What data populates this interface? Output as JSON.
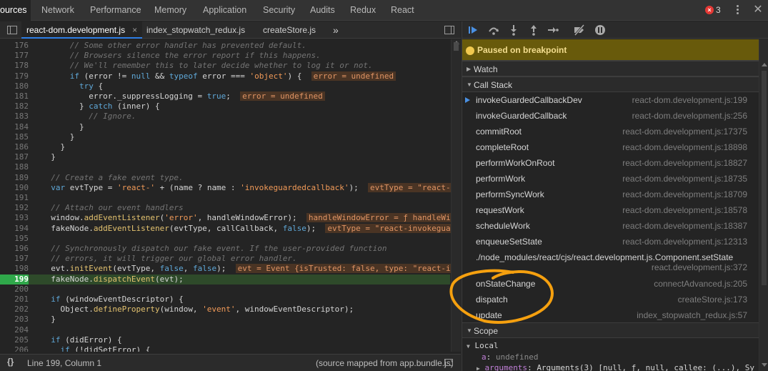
{
  "top_tabs": [
    {
      "label": "ources",
      "active": true
    },
    {
      "label": "Network",
      "active": false
    },
    {
      "label": "Performance",
      "active": false
    },
    {
      "label": "Memory",
      "active": false
    },
    {
      "label": "Application",
      "active": false
    },
    {
      "label": "Security",
      "active": false
    },
    {
      "label": "Audits",
      "active": false
    },
    {
      "label": "Redux",
      "active": false
    },
    {
      "label": "React",
      "active": false
    }
  ],
  "errors": {
    "count": "3",
    "icon": "error-circle-icon",
    "color": "#e53935"
  },
  "file_tabs": [
    {
      "label": "react-dom.development.js",
      "active": true,
      "close": "×"
    },
    {
      "label": "index_stopwatch_redux.js",
      "active": false
    },
    {
      "label": "createStore.js",
      "active": false
    }
  ],
  "file_tabs_more": "»",
  "code": {
    "current_line": "199",
    "lines": [
      {
        "n": "176",
        "html": "<span class='c-com'>      // Some other error handler has prevented default.</span>"
      },
      {
        "n": "177",
        "html": "<span class='c-com'>      // Browsers silence the error report if this happens.</span>"
      },
      {
        "n": "178",
        "html": "<span class='c-com'>      // We'll remember this to later decide whether to log it or not.</span>"
      },
      {
        "n": "179",
        "html": "      <span class='c-kw'>if</span> (error != <span class='c-kw'>null</span> &amp;&amp; <span class='c-kw'>typeof</span> error === <span class='c-str'>'object'</span>) {  <span class='inl'>error = undefined</span>"
      },
      {
        "n": "180",
        "html": "        <span class='c-kw'>try</span> {"
      },
      {
        "n": "181",
        "html": "          error._suppressLogging = <span class='c-kw'>true</span>;  <span class='inl'>error = undefined</span>"
      },
      {
        "n": "182",
        "html": "        } <span class='c-kw'>catch</span> (inner) {"
      },
      {
        "n": "183",
        "html": "<span class='c-com'>          // Ignore.</span>"
      },
      {
        "n": "184",
        "html": "        }"
      },
      {
        "n": "185",
        "html": "      }"
      },
      {
        "n": "186",
        "html": "    }"
      },
      {
        "n": "187",
        "html": "  }"
      },
      {
        "n": "188",
        "html": ""
      },
      {
        "n": "189",
        "html": "<span class='c-com'>  // Create a fake event type.</span>"
      },
      {
        "n": "190",
        "html": "  <span class='c-kw'>var</span> evtType = <span class='c-str'>'react-'</span> + (name ? name : <span class='c-str'>'invokeguardedcallback'</span>);  <span class='inl'>evtType = \"react-i</span>"
      },
      {
        "n": "191",
        "html": ""
      },
      {
        "n": "192",
        "html": "<span class='c-com'>  // Attach our event handlers</span>"
      },
      {
        "n": "193",
        "html": "  window.<span class='c-fn'>addEventListener</span>(<span class='c-str'>'error'</span>, handleWindowError);  <span class='inl'>handleWindowError = ƒ handleWin</span>"
      },
      {
        "n": "194",
        "html": "  fakeNode.<span class='c-fn'>addEventListener</span>(evtType, callCallback, <span class='c-kw'>false</span>);  <span class='inl'>evtType = \"react-invokegua</span>"
      },
      {
        "n": "195",
        "html": ""
      },
      {
        "n": "196",
        "html": "<span class='c-com'>  // Synchronously dispatch our fake event. If the user-provided function</span>"
      },
      {
        "n": "197",
        "html": "<span class='c-com'>  // errors, it will trigger our global error handler.</span>"
      },
      {
        "n": "198",
        "html": "  evt.<span class='c-fn'>initEvent</span>(evtType, <span class='c-kw'>false</span>, <span class='c-kw'>false</span>);  <span class='inl'>evt = Event {isTrusted: false, type: \"react-in</span>"
      },
      {
        "n": "199",
        "html": "  fakeNode.<span class='c-fn'>dispatchEvent</span>(evt);"
      },
      {
        "n": "200",
        "html": ""
      },
      {
        "n": "201",
        "html": "  <span class='c-kw'>if</span> (windowEventDescriptor) {"
      },
      {
        "n": "202",
        "html": "    Object.<span class='c-fn'>defineProperty</span>(window, <span class='c-str'>'event'</span>, windowEventDescriptor);"
      },
      {
        "n": "203",
        "html": "  }"
      },
      {
        "n": "204",
        "html": ""
      },
      {
        "n": "205",
        "html": "  <span class='c-kw'>if</span> (didError) {"
      },
      {
        "n": "206",
        "html": "    <span class='c-kw'>if</span> (!didSetError) {"
      }
    ]
  },
  "status": {
    "braces": "{}",
    "position": "Line 199, Column 1",
    "source": "(source mapped from app.bundle.js)"
  },
  "debugger": {
    "toolbar_icons": [
      "resume-icon",
      "step-over-icon",
      "step-into-icon",
      "step-out-icon",
      "step-icon",
      "deactivate-breakpoints-icon",
      "pause-on-exceptions-icon"
    ],
    "paused_text": "Paused on breakpoint",
    "paused_color": "#685a0b",
    "watch_label": "Watch",
    "call_stack_label": "Call Stack",
    "scope_label": "Scope",
    "frames": [
      {
        "fn": "invokeGuardedCallbackDev",
        "loc": "react-dom.development.js:199",
        "current": true
      },
      {
        "fn": "invokeGuardedCallback",
        "loc": "react-dom.development.js:256"
      },
      {
        "fn": "commitRoot",
        "loc": "react-dom.development.js:17375"
      },
      {
        "fn": "completeRoot",
        "loc": "react-dom.development.js:18898"
      },
      {
        "fn": "performWorkOnRoot",
        "loc": "react-dom.development.js:18827"
      },
      {
        "fn": "performWork",
        "loc": "react-dom.development.js:18735"
      },
      {
        "fn": "performSyncWork",
        "loc": "react-dom.development.js:18709"
      },
      {
        "fn": "requestWork",
        "loc": "react-dom.development.js:18578"
      },
      {
        "fn": "scheduleWork",
        "loc": "react-dom.development.js:18387"
      },
      {
        "fn": "enqueueSetState",
        "loc": "react-dom.development.js:12313"
      },
      {
        "fn": "./node_modules/react/cjs/react.development.js.Component.setState",
        "loc": "react.development.js:372",
        "tall": true
      },
      {
        "fn": "onStateChange",
        "loc": "connectAdvanced.js:205"
      },
      {
        "fn": "dispatch",
        "loc": "createStore.js:173"
      },
      {
        "fn": "update",
        "loc": "index_stopwatch_redux.js:57"
      }
    ],
    "scope": {
      "local_label": "Local",
      "vars": [
        {
          "key": "a",
          "value": "undefined"
        },
        {
          "key": "arguments",
          "value": "Arguments(3) [null, ƒ, null, callee: (...), Sy"
        }
      ]
    }
  },
  "annotation_color": "#f5a00f"
}
